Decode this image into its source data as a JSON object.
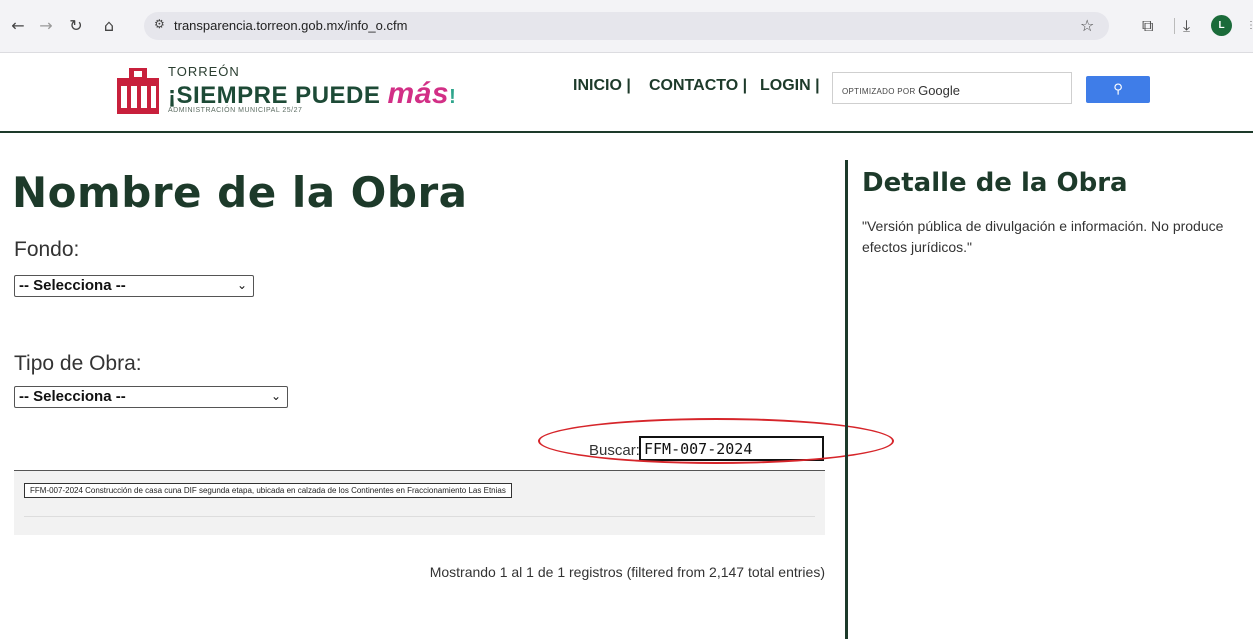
{
  "browser": {
    "url": "transparencia.torreon.gob.mx/info_o.cfm",
    "profile_initial": "L"
  },
  "header": {
    "logo": {
      "city": "TORREÓN",
      "slogan": "¡SIEMPRE PUEDE ",
      "slogan_mas": "más",
      "admin": "ADMINISTRACIÓN MUNICIPAL 25/27"
    },
    "menu": {
      "inicio": "INICIO |",
      "contacto": "CONTACTO |",
      "login": "LOGIN |"
    },
    "search": {
      "optimized_by": "OPTIMIZADO POR",
      "brand": "Google",
      "button_icon": "search-icon"
    }
  },
  "main": {
    "title": "Nombre de la Obra",
    "fondo": {
      "label": "Fondo:",
      "selected": "-- Selecciona --"
    },
    "tipo_obra": {
      "label": "Tipo de Obra:",
      "selected": "-- Selecciona --"
    },
    "buscar": {
      "label": "Buscar:",
      "value": "FFM-007-2024"
    },
    "results": [
      "FFM-007-2024 Construcción de casa cuna DIF segunda etapa, ubicada en calzada de los Continentes en Fraccionamiento Las Etnias"
    ],
    "info": "Mostrando 1 al 1 de 1 registros (filtered from 2,147 total entries)"
  },
  "detail": {
    "title": "Detalle de la Obra",
    "note": "\"Versión pública de divulgación e información. No produce efectos jurídicos.\""
  },
  "colors": {
    "brand_green": "#1d3a2a",
    "accent_magenta": "#d22f86",
    "highlight_red": "#d6252a",
    "search_blue": "#3f7de8"
  }
}
